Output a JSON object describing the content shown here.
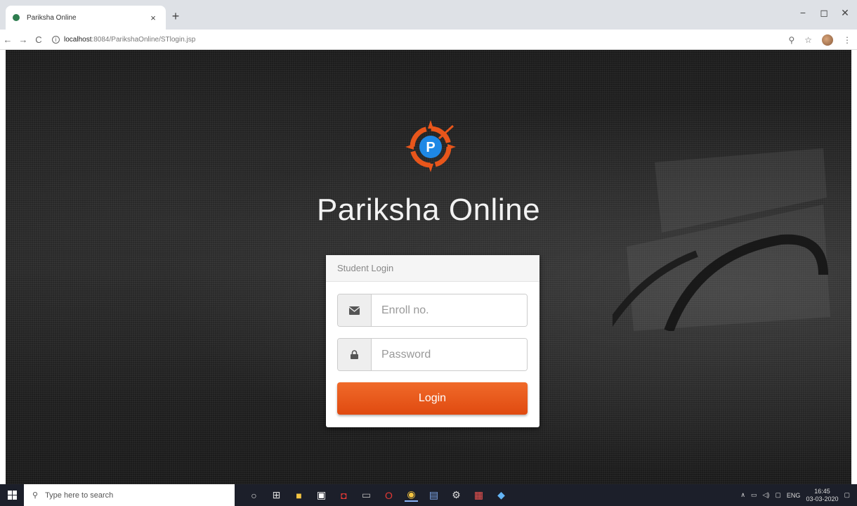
{
  "browser": {
    "tab_title": "Pariksha Online",
    "url_host": "localhost",
    "url_path": ":8084/ParikshaOnline/STlogin.jsp",
    "controls": {
      "back": "←",
      "forward": "→",
      "reload": "C",
      "minimize": "−",
      "maximize": "◻",
      "close": "✕",
      "new_tab": "+",
      "tab_close": "×"
    }
  },
  "page": {
    "brand_name": "Pariksha Online",
    "login_card": {
      "header": "Student Login",
      "enroll_placeholder": "Enroll no.",
      "password_placeholder": "Password",
      "submit_label": "Login"
    }
  },
  "taskbar": {
    "search_placeholder": "Type here to search",
    "language": "ENG",
    "time": "16:45",
    "date": "03-03-2020"
  },
  "colors": {
    "accent": "#e8561b",
    "logo_blue": "#1e88e5"
  }
}
